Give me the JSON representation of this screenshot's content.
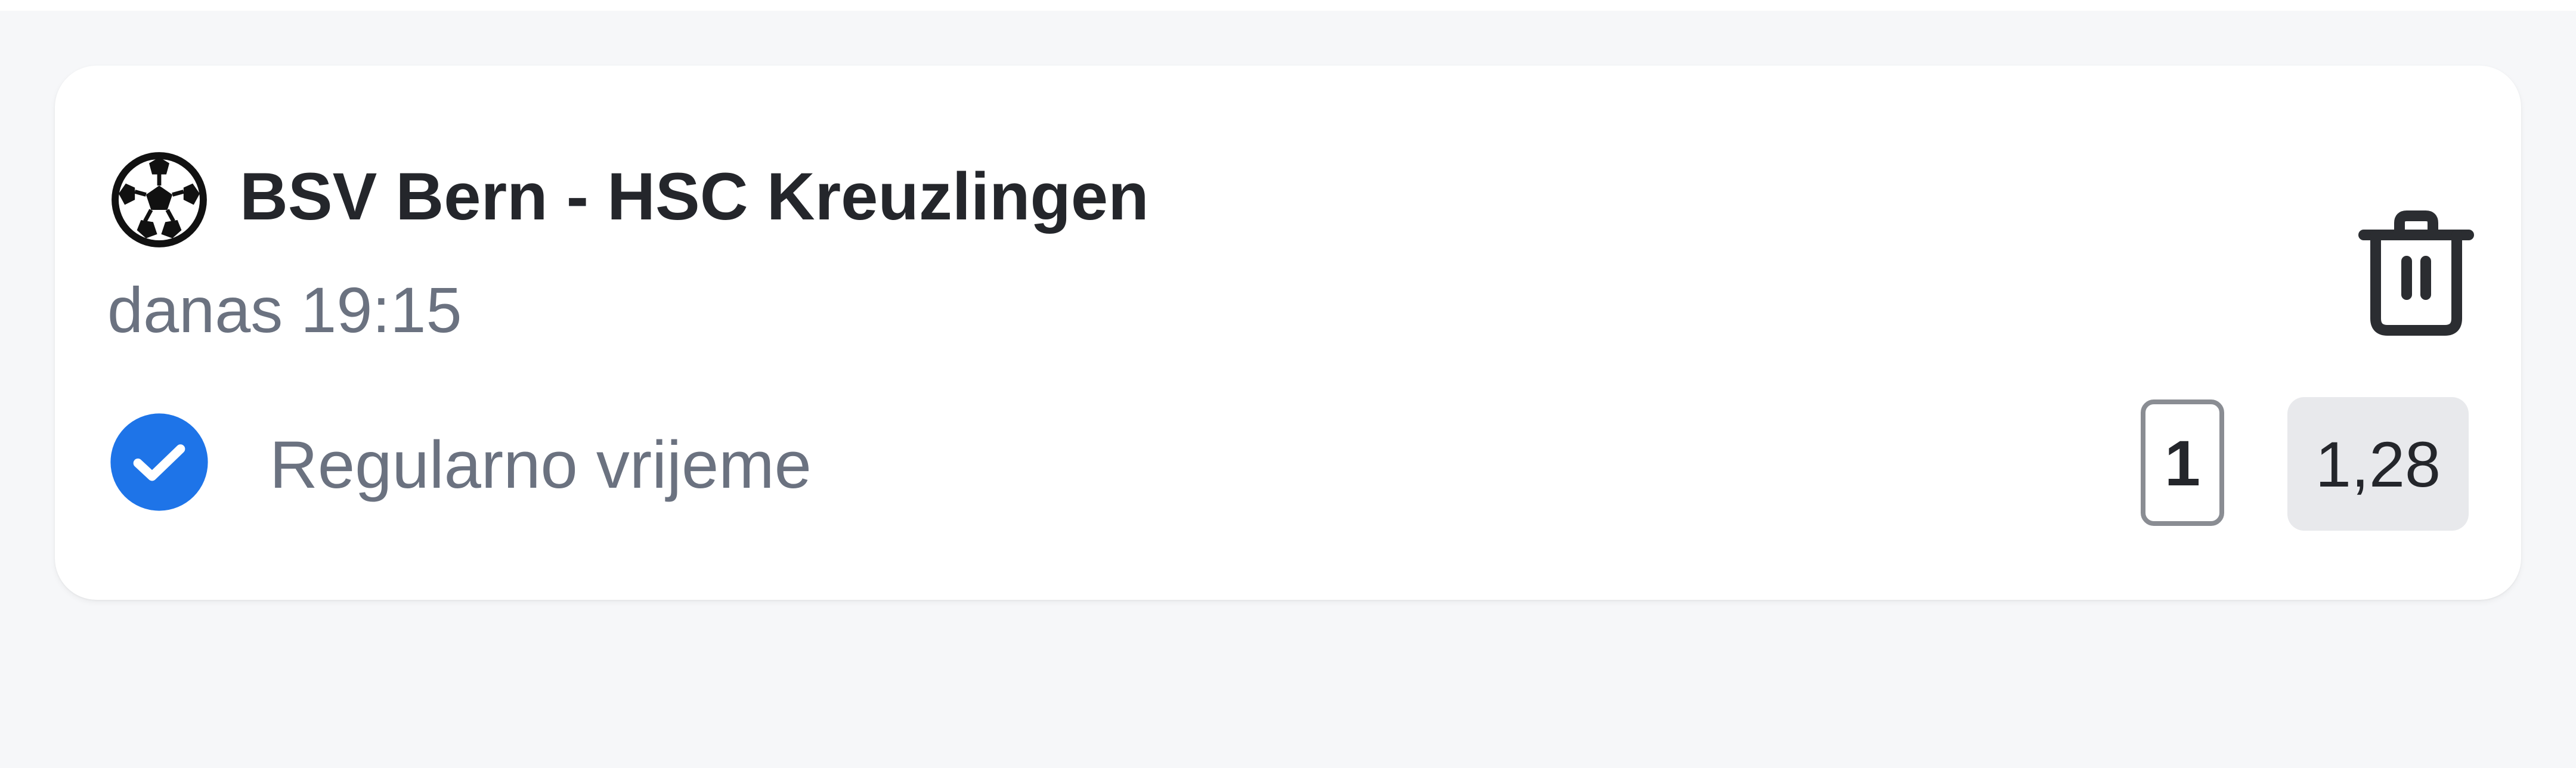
{
  "match": {
    "sport_icon": "handball-ball-icon",
    "title": "BSV Bern - HSC Kreuzlingen",
    "time": "danas 19:15"
  },
  "bet": {
    "status_icon": "check-circle-icon",
    "market": "Regularno vrijeme",
    "selection": "1",
    "odds": "1,28"
  },
  "actions": {
    "delete_icon": "trash-icon"
  },
  "colors": {
    "background": "#f6f7f9",
    "card": "#ffffff",
    "accent": "#1e74e8",
    "title_text": "#24262b",
    "muted_text": "#6b7280",
    "odds_bg": "#e8e9ec"
  }
}
